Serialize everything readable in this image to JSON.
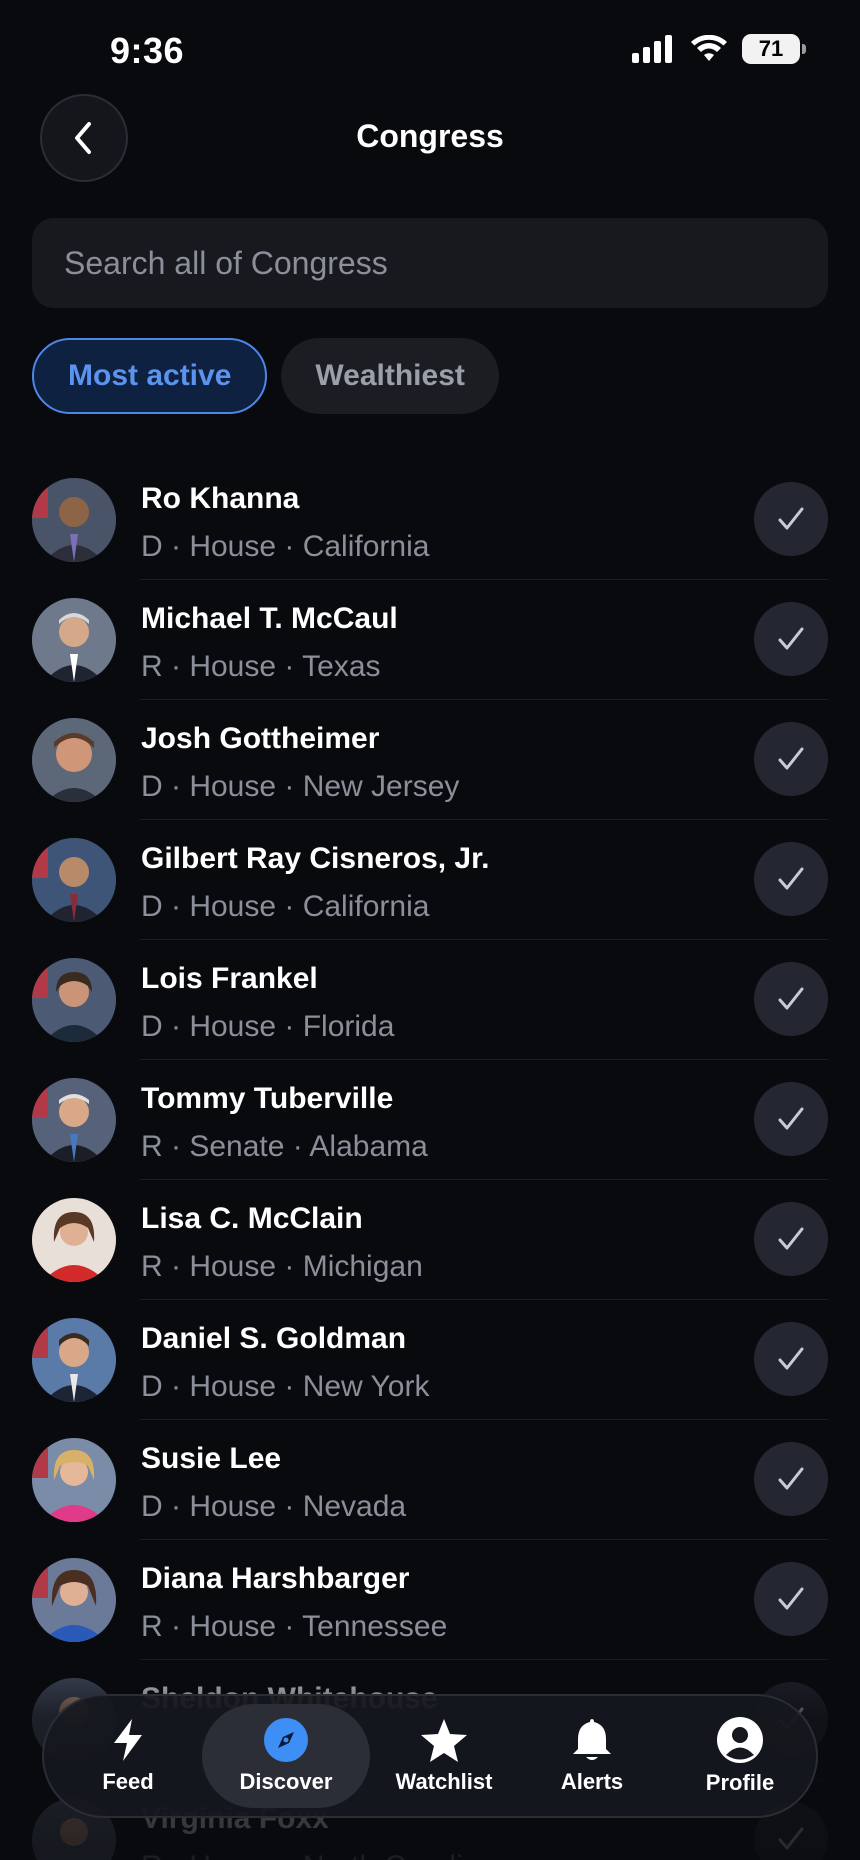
{
  "status": {
    "time": "9:36",
    "battery": "71"
  },
  "header": {
    "title": "Congress"
  },
  "search": {
    "placeholder": "Search all of Congress"
  },
  "filters": [
    {
      "label": "Most active",
      "active": true
    },
    {
      "label": "Wealthiest",
      "active": false
    }
  ],
  "members": [
    {
      "name": "Ro Khanna",
      "meta": "D · House · California"
    },
    {
      "name": "Michael T. McCaul",
      "meta": "R · House · Texas"
    },
    {
      "name": "Josh Gottheimer",
      "meta": "D · House · New Jersey"
    },
    {
      "name": "Gilbert Ray Cisneros, Jr.",
      "meta": "D · House · California"
    },
    {
      "name": "Lois Frankel",
      "meta": "D · House · Florida"
    },
    {
      "name": "Tommy Tuberville",
      "meta": "R · Senate · Alabama"
    },
    {
      "name": "Lisa C. McClain",
      "meta": "R · House · Michigan"
    },
    {
      "name": "Daniel S. Goldman",
      "meta": "D · House · New York"
    },
    {
      "name": "Susie Lee",
      "meta": "D · House · Nevada"
    },
    {
      "name": "Diana Harshbarger",
      "meta": "R · House · Tennessee"
    },
    {
      "name": "Sheldon Whitehouse",
      "meta": ""
    },
    {
      "name": "Virginia Foxx",
      "meta": "R · House · North Carolina"
    }
  ],
  "tabs": [
    {
      "label": "Feed",
      "icon": "lightning-icon",
      "active": false
    },
    {
      "label": "Discover",
      "icon": "compass-icon",
      "active": true
    },
    {
      "label": "Watchlist",
      "icon": "star-icon",
      "active": false
    },
    {
      "label": "Alerts",
      "icon": "bell-icon",
      "active": false
    },
    {
      "label": "Profile",
      "icon": "profile-icon",
      "active": false
    }
  ],
  "colors": {
    "background": "#090a0e",
    "accent": "#4f86e6",
    "discover_icon": "#3d8ef5"
  }
}
